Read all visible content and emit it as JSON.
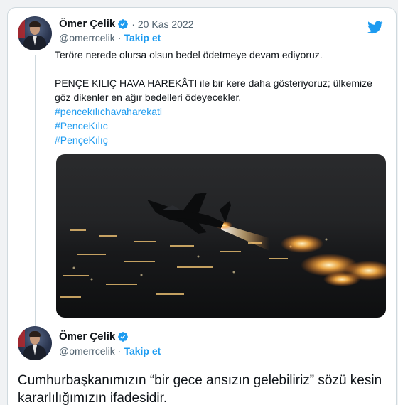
{
  "tweet1": {
    "author_name": "Ömer Çelik",
    "handle": "@omerrcelik",
    "separator": "·",
    "follow_label": "Takip et",
    "date": "20 Kas 2022",
    "line1": "Teröre nerede olursa olsun bedel ödetmeye devam ediyoruz.",
    "line2": "PENÇE KILIÇ HAVA HAREKÂTI ile bir kere daha gösteriyoruz; ülkemize göz dikenler en ağır bedelleri ödeyecekler.",
    "hashtags": [
      "#pencekılıchavaharekati",
      "#PenceKılıc",
      "#PençeKılıç"
    ]
  },
  "tweet2": {
    "author_name": "Ömer Çelik",
    "handle": "@omerrcelik",
    "separator": "·",
    "follow_label": "Takip et",
    "text": "Cumhurbaşkanımızın “bir gece ansızın gelebiliriz” sözü kesin kararlılığımızın ifadesidir."
  },
  "icons": {
    "verified": "verified-badge-icon",
    "brand": "twitter-bird-icon",
    "avatar": "profile-photo"
  },
  "colors": {
    "link": "#1d9bf0",
    "secondary_text": "#536471",
    "border": "#cfd9de"
  }
}
